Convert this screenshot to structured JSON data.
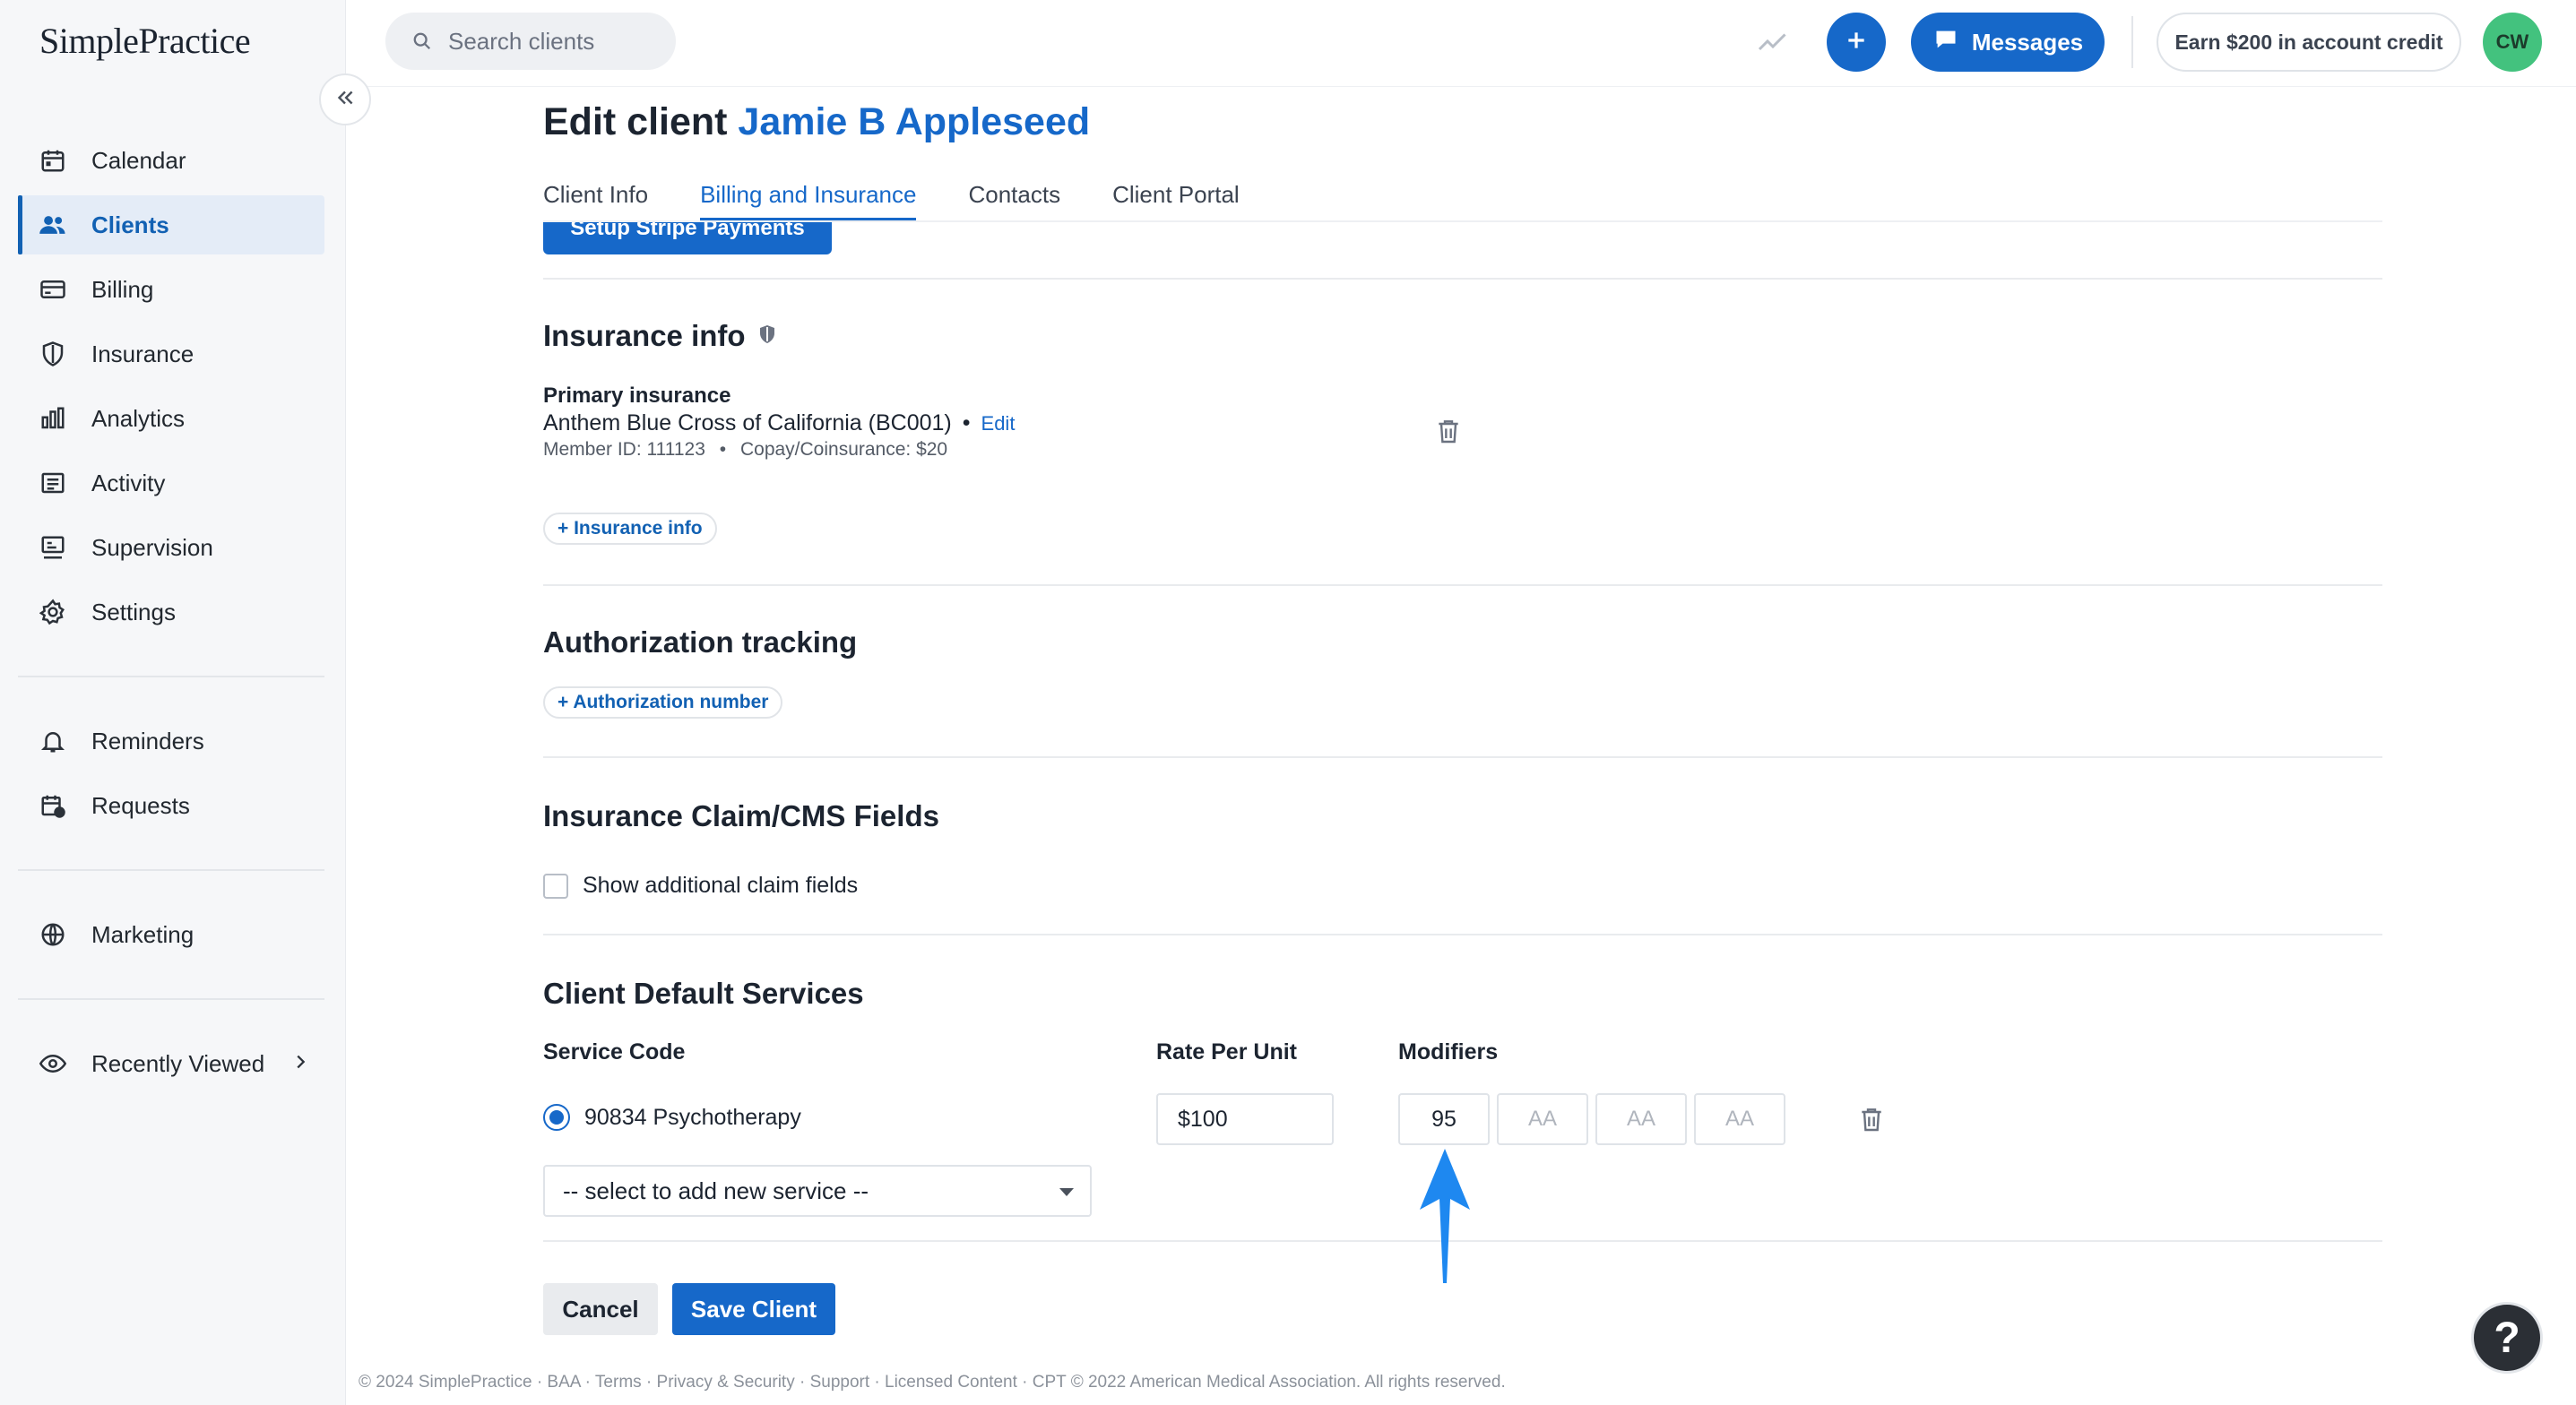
{
  "brand": {
    "logo_text": "SimplePractice",
    "accent": "#1668c9"
  },
  "sidebar": {
    "items": [
      {
        "label": "Calendar",
        "icon": "calendar-icon"
      },
      {
        "label": "Clients",
        "icon": "clients-icon",
        "active": true
      },
      {
        "label": "Billing",
        "icon": "billing-icon"
      },
      {
        "label": "Insurance",
        "icon": "shield-icon"
      },
      {
        "label": "Analytics",
        "icon": "analytics-icon"
      },
      {
        "label": "Activity",
        "icon": "activity-icon"
      },
      {
        "label": "Supervision",
        "icon": "supervision-icon"
      },
      {
        "label": "Settings",
        "icon": "gear-icon"
      }
    ],
    "secondary": [
      {
        "label": "Reminders",
        "icon": "bell-icon"
      },
      {
        "label": "Requests",
        "icon": "requests-icon"
      }
    ],
    "tertiary": [
      {
        "label": "Marketing",
        "icon": "globe-icon"
      }
    ],
    "recent": {
      "label": "Recently Viewed",
      "icon": "eye-icon"
    }
  },
  "header": {
    "search_placeholder": "Search clients",
    "messages_label": "Messages",
    "credit_label": "Earn $200 in account credit",
    "avatar_initials": "CW"
  },
  "page": {
    "title_prefix": "Edit client",
    "client_name": "Jamie B Appleseed",
    "tabs": [
      {
        "label": "Client Info"
      },
      {
        "label": "Billing and Insurance",
        "active": true
      },
      {
        "label": "Contacts"
      },
      {
        "label": "Client Portal"
      }
    ],
    "stripe_button": "Setup Stripe Payments"
  },
  "insurance": {
    "title": "Insurance info",
    "primary_label": "Primary insurance",
    "plan": "Anthem Blue Cross of California (BC001)",
    "bullet": "•",
    "edit_label": "Edit",
    "member_id": "Member ID: 111123",
    "copay": "Copay/Coinsurance: $20",
    "add_label": "+ Insurance info"
  },
  "authorization": {
    "title": "Authorization tracking",
    "add_label": "+ Authorization number"
  },
  "claim": {
    "title": "Insurance Claim/CMS Fields",
    "checkbox_label": "Show additional claim fields",
    "checked": false
  },
  "services": {
    "title": "Client Default Services",
    "col_service": "Service Code",
    "col_rate": "Rate Per Unit",
    "col_modifiers": "Modifiers",
    "service_name": "90834 Psychotherapy",
    "rate": "$100",
    "modifiers": [
      "95"
    ],
    "modifier_placeholder": "AA",
    "select_label": "-- select to add new service --"
  },
  "actions": {
    "cancel": "Cancel",
    "save": "Save Client"
  },
  "footer": "© 2024 SimplePractice · BAA · Terms · Privacy & Security · Support · Licensed Content · CPT © 2022 American Medical Association. All rights reserved.",
  "help_label": "?"
}
